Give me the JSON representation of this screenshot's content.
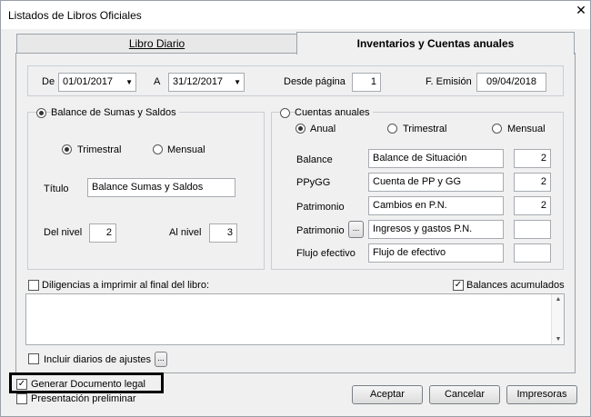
{
  "window": {
    "title": "Listados de Libros Oficiales"
  },
  "tabs": [
    {
      "label": "Libro Diario"
    },
    {
      "label": "Inventarios y Cuentas anuales"
    }
  ],
  "range": {
    "de_label": "De",
    "from_date": "01/01/2017",
    "a_label": "A",
    "to_date": "31/12/2017",
    "desde_pagina_label": "Desde página",
    "desde_pagina": "1",
    "emision_label": "F. Emisión",
    "emision_date": "09/04/2018"
  },
  "balance_sumas": {
    "radio_label": "Balance de Sumas y Saldos",
    "trimestral": "Trimestral",
    "mensual": "Mensual",
    "titulo_label": "Título",
    "titulo_value": "Balance Sumas y Saldos",
    "del_nivel_label": "Del nivel",
    "del_nivel_value": "2",
    "al_nivel_label": "Al nivel",
    "al_nivel_value": "3"
  },
  "cuentas_anuales": {
    "radio_label": "Cuentas anuales",
    "anual": "Anual",
    "trimestral": "Trimestral",
    "mensual": "Mensual",
    "rows": [
      {
        "label": "Balance",
        "value": "Balance de Situación",
        "num": "2"
      },
      {
        "label": "PPyGG",
        "value": "Cuenta de PP y GG",
        "num": "2"
      },
      {
        "label": "Patrimonio",
        "value": "Cambios en  P.N.",
        "num": "2"
      },
      {
        "label": "Patrimonio",
        "value": "Ingresos y gastos P.N.",
        "num": ""
      },
      {
        "label": "Flujo efectivo",
        "value": "Flujo de efectivo",
        "num": ""
      }
    ],
    "ellipsis": "..."
  },
  "diligencias_label": "Diligencias a imprimir al final del libro:",
  "balances_acumulados_label": "Balances acumulados",
  "incluir_diarios_label": "Incluir diarios de ajustes",
  "incluir_ellipsis": "...",
  "generar_documento_label": "Generar Documento legal",
  "presentacion_label": "Presentación preliminar",
  "buttons": {
    "aceptar": "Aceptar",
    "cancelar": "Cancelar",
    "impresoras": "Impresoras"
  },
  "icons": {
    "close": "close-icon",
    "combo_arrow": "chevron-down-icon",
    "check": "check-icon"
  }
}
